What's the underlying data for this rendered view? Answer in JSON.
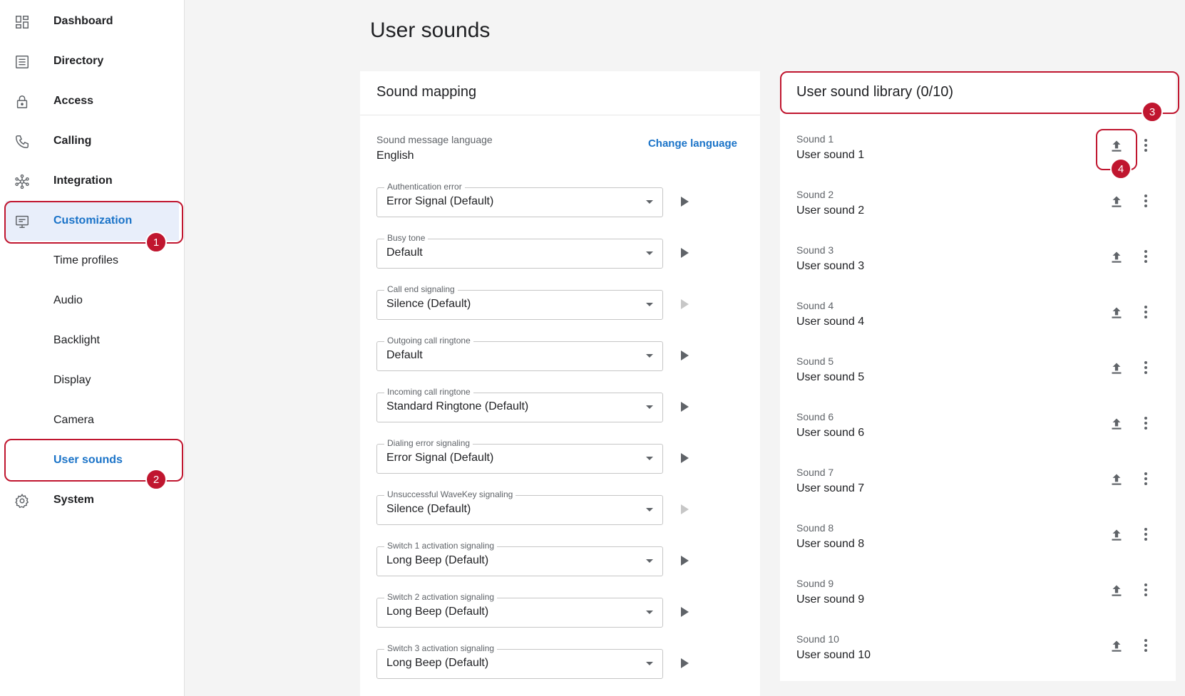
{
  "page_title": "User sounds",
  "colors": {
    "accent": "#1a73c8",
    "callout": "#c0162f"
  },
  "sidebar": {
    "items": [
      {
        "label": "Dashboard",
        "icon": "dashboard-icon"
      },
      {
        "label": "Directory",
        "icon": "directory-icon"
      },
      {
        "label": "Access",
        "icon": "lock-icon"
      },
      {
        "label": "Calling",
        "icon": "phone-icon"
      },
      {
        "label": "Integration",
        "icon": "integration-icon"
      },
      {
        "label": "Customization",
        "icon": "customization-icon",
        "active": true
      },
      {
        "label": "Time profiles"
      },
      {
        "label": "Audio"
      },
      {
        "label": "Backlight"
      },
      {
        "label": "Display"
      },
      {
        "label": "Camera"
      },
      {
        "label": "User sounds",
        "active": true
      },
      {
        "label": "System",
        "icon": "gear-icon"
      }
    ]
  },
  "mapping": {
    "title": "Sound mapping",
    "language_caption": "Sound message language",
    "language_value": "English",
    "change_language": "Change language",
    "fields": [
      {
        "label": "Authentication error",
        "value": "Error Signal (Default)",
        "play_enabled": true
      },
      {
        "label": "Busy tone",
        "value": "Default",
        "play_enabled": true
      },
      {
        "label": "Call end signaling",
        "value": "Silence (Default)",
        "play_enabled": false
      },
      {
        "label": "Outgoing call ringtone",
        "value": "Default",
        "play_enabled": true
      },
      {
        "label": "Incoming call ringtone",
        "value": "Standard Ringtone (Default)",
        "play_enabled": true
      },
      {
        "label": "Dialing error signaling",
        "value": "Error Signal (Default)",
        "play_enabled": true
      },
      {
        "label": "Unsuccessful WaveKey signaling",
        "value": "Silence (Default)",
        "play_enabled": false
      },
      {
        "label": "Switch 1 activation signaling",
        "value": "Long Beep (Default)",
        "play_enabled": true
      },
      {
        "label": "Switch 2 activation signaling",
        "value": "Long Beep (Default)",
        "play_enabled": true
      },
      {
        "label": "Switch 3 activation signaling",
        "value": "Long Beep (Default)",
        "play_enabled": true
      }
    ]
  },
  "library": {
    "title": "User sound library (0/10)",
    "sounds": [
      {
        "label": "Sound 1",
        "name": "User sound 1"
      },
      {
        "label": "Sound 2",
        "name": "User sound 2"
      },
      {
        "label": "Sound 3",
        "name": "User sound 3"
      },
      {
        "label": "Sound 4",
        "name": "User sound 4"
      },
      {
        "label": "Sound 5",
        "name": "User sound 5"
      },
      {
        "label": "Sound 6",
        "name": "User sound 6"
      },
      {
        "label": "Sound 7",
        "name": "User sound 7"
      },
      {
        "label": "Sound 8",
        "name": "User sound 8"
      },
      {
        "label": "Sound 9",
        "name": "User sound 9"
      },
      {
        "label": "Sound 10",
        "name": "User sound 10"
      }
    ]
  },
  "callouts": [
    "1",
    "2",
    "3",
    "4"
  ]
}
